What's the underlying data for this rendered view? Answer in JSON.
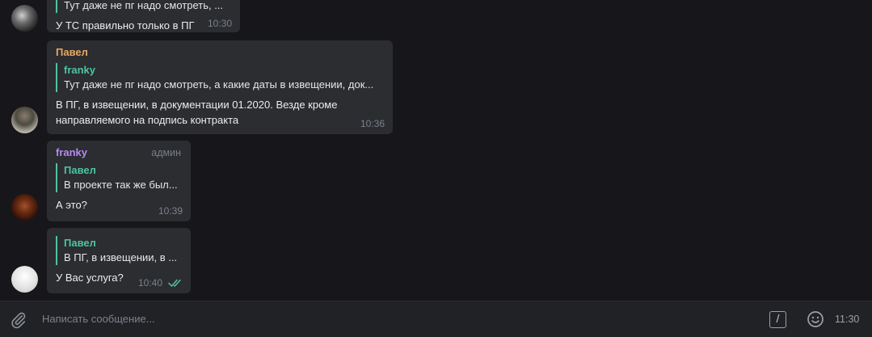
{
  "messages": [
    {
      "reply": {
        "text": "Тут даже не пг надо смотреть, ..."
      },
      "text": "У ТС правильно только в ПГ",
      "time": "10:30"
    },
    {
      "sender": "Павел",
      "reply": {
        "name": "franky",
        "text": "Тут даже не пг надо смотреть, а какие даты в извещении, док..."
      },
      "text_line1": "В ПГ, в извещении, в документации 01.2020. Везде кроме",
      "text_line2": "направляемого на подпись контракта",
      "time": "10:36"
    },
    {
      "sender": "franky",
      "badge": "админ",
      "reply": {
        "name": "Павел",
        "text": "В проекте так же был..."
      },
      "text": "А это?",
      "time": "10:39"
    },
    {
      "reply": {
        "name": "Павел",
        "text": "В ПГ, в извещении, в ..."
      },
      "text": "У Вас услуга?",
      "time": "10:40",
      "status": "read"
    }
  ],
  "composer": {
    "placeholder": "Написать сообщение...",
    "commands_label": "/",
    "time": "11:30"
  },
  "colors": {
    "background": "#17171b",
    "bubble": "#2b2d31",
    "accent_green": "#4fc3a1",
    "sender_orange": "#e8a764",
    "sender_purple": "#b48cf2"
  }
}
